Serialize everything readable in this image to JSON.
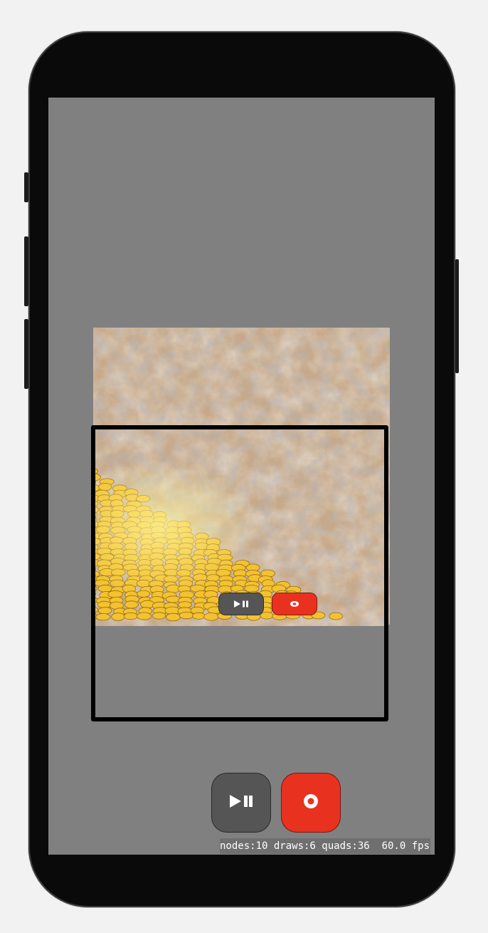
{
  "device": {
    "model": "iPhone frame"
  },
  "scene": {
    "background": "cloudy-sand",
    "sprite": "gold-coin",
    "colors": {
      "coin": "#f2c230",
      "coin_edge": "#9a6a10",
      "sand": "#b79a7c",
      "screen_gray": "#808080"
    }
  },
  "controls": {
    "mini_play_icon": "play-pause-icon",
    "mini_record_icon": "record-icon",
    "play_icon": "play-pause-icon",
    "record_icon": "record-icon",
    "record_color": "#e8321f",
    "play_color": "#555555"
  },
  "stats": {
    "text": "nodes:10 draws:6 quads:36  60.0 fps"
  }
}
